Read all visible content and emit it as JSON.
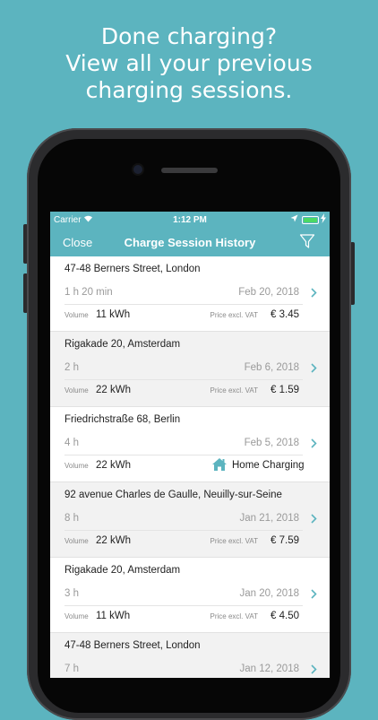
{
  "headline": [
    "Done charging?",
    "View all your previous",
    "charging sessions."
  ],
  "status": {
    "carrier": "Carrier",
    "time": "1:12 PM"
  },
  "navbar": {
    "close_label": "Close",
    "title": "Charge Session History"
  },
  "labels": {
    "volume": "Volume",
    "price": "Price excl. VAT"
  },
  "colors": {
    "accent": "#5cb4bf",
    "battery": "#4cd964"
  },
  "icons": {
    "filter": "filter-icon",
    "chevron": "chevron-right-icon",
    "home": "home-icon"
  },
  "sessions": [
    {
      "address": "47-48 Berners Street, London",
      "duration": "1 h 20 min",
      "date": "Feb 20, 2018",
      "volume": "11 kWh",
      "price": "€ 3.45"
    },
    {
      "address": "Rigakade 20, Amsterdam",
      "duration": "2 h",
      "date": "Feb 6, 2018",
      "volume": "22 kWh",
      "price": "€ 1.59"
    },
    {
      "address": "Friedrichstraße 68, Berlin",
      "duration": "4 h",
      "date": "Feb 5, 2018",
      "volume": "22 kWh",
      "home": "Home Charging"
    },
    {
      "address": "92 avenue Charles de Gaulle, Neuilly-sur-Seine",
      "duration": "8 h",
      "date": "Jan 21, 2018",
      "volume": "22 kWh",
      "price": "€ 7.59"
    },
    {
      "address": "Rigakade 20, Amsterdam",
      "duration": "3 h",
      "date": "Jan 20, 2018",
      "volume": "11 kWh",
      "price": "€ 4.50"
    },
    {
      "address": "47-48 Berners Street, London",
      "duration": "7 h",
      "date": "Jan 12, 2018"
    }
  ]
}
